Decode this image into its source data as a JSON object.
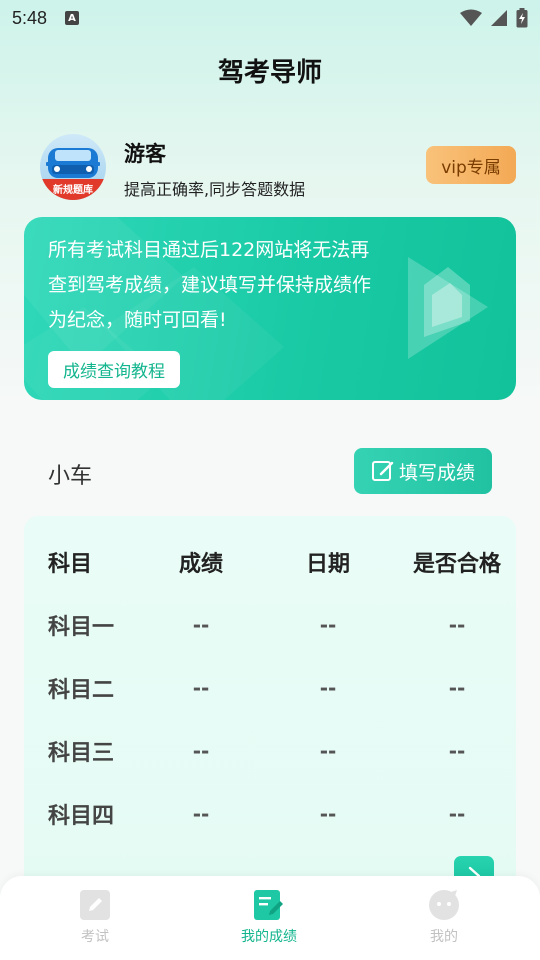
{
  "status_bar": {
    "time": "5:48",
    "indicator": "A"
  },
  "header": {
    "title": "驾考导师"
  },
  "user": {
    "name": "游客",
    "subtitle": "提高正确率,同步答题数据",
    "avatar_caption": "新规题库",
    "vip_label": "vip专属"
  },
  "banner": {
    "text": "所有考试科目通过后122网站将无法再查到驾考成绩，建议填写并保持成绩作为纪念，随时可回看!",
    "button_label": "成绩查询教程"
  },
  "section": {
    "title": "小车",
    "fill_button_label": "填写成绩"
  },
  "score_table": {
    "headers": [
      "科目",
      "成绩",
      "日期",
      "是否合格"
    ],
    "rows": [
      [
        "科目一",
        "--",
        "--",
        "--"
      ],
      [
        "科目二",
        "--",
        "--",
        "--"
      ],
      [
        "科目三",
        "--",
        "--",
        "--"
      ],
      [
        "科目四",
        "--",
        "--",
        "--"
      ]
    ]
  },
  "bottom_nav": {
    "items": [
      {
        "label": "考试",
        "icon": "pencil-icon",
        "active": false
      },
      {
        "label": "我的成绩",
        "icon": "score-sheet-icon",
        "active": true
      },
      {
        "label": "我的",
        "icon": "profile-face-icon",
        "active": false
      }
    ]
  },
  "colors": {
    "accent": "#13b58e",
    "banner": "#18c9a4",
    "vip": "#f3a955",
    "nav_inactive": "#c2c2c2"
  }
}
